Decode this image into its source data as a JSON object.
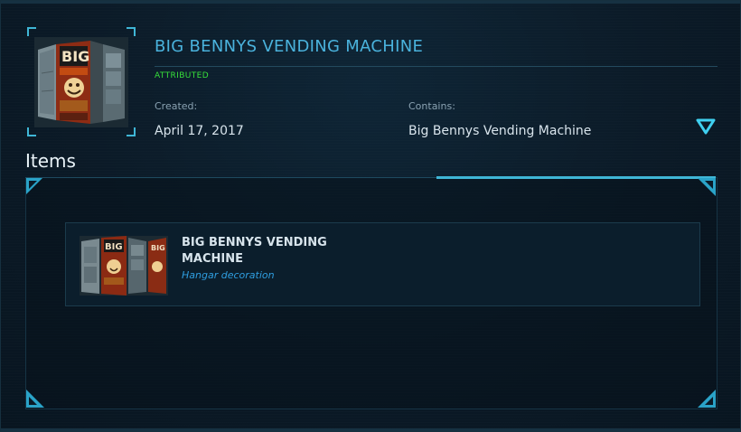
{
  "pledge": {
    "title": "BIG BENNYS VENDING MACHINE",
    "status": "ATTRIBUTED",
    "created_label": "Created:",
    "created_value": "April 17, 2017",
    "contains_label": "Contains:",
    "contains_value": "Big Bennys Vending Machine",
    "image_icon": "vending-machine-thumbnail",
    "expand_icon": "chevron-down-triangle-icon"
  },
  "items": {
    "heading": "Items",
    "list": [
      {
        "name": "BIG BENNYS VENDING MACHINE",
        "type": "Hangar decoration",
        "image_icon": "vending-machine-thumbnail"
      }
    ]
  },
  "colors": {
    "accent": "#3fb6d6",
    "title": "#4ab2dc",
    "status": "#37e03a",
    "item_type": "#2f9ee0",
    "background": "#0a1824"
  }
}
